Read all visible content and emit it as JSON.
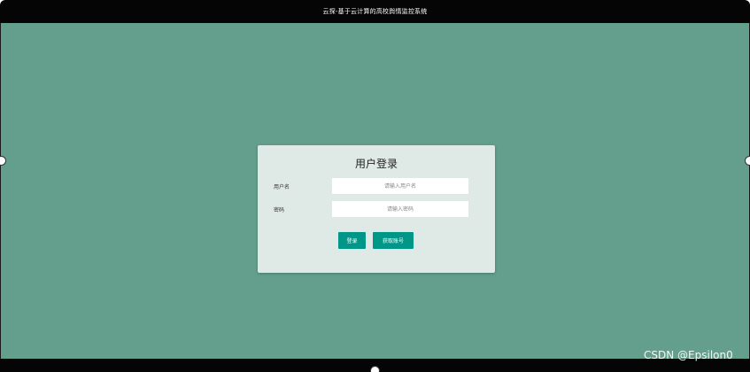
{
  "window": {
    "title": "云探-基于云计算的高校舆情监控系统"
  },
  "login": {
    "heading": "用户登录",
    "username_label": "用户名",
    "username_placeholder": "请输入用户名",
    "username_value": "",
    "password_label": "密码",
    "password_placeholder": "请输入密码",
    "password_value": "",
    "login_button": "登录",
    "get_account_button": "获取账号"
  },
  "watermark": {
    "text": "CSDN @Epsilon0"
  },
  "colors": {
    "titlebar_bg": "#050505",
    "stage_bg": "#639f8c",
    "card_bg": "#dfe9e6",
    "button_bg": "#009688",
    "button_text": "#ffffff"
  }
}
